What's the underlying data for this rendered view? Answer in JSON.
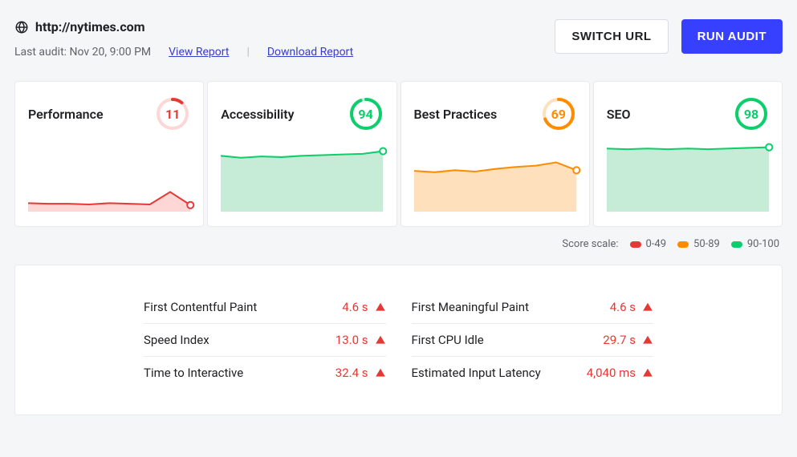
{
  "header": {
    "url": "http://nytimes.com",
    "last_audit_label": "Last audit: Nov 20, 9:00 PM",
    "view_report": "View Report",
    "download_report": "Download Report",
    "separator": "|"
  },
  "buttons": {
    "switch_url": "Switch URL",
    "run_audit": "Run Audit"
  },
  "cards": [
    {
      "title": "Performance",
      "score": 11,
      "level": "red"
    },
    {
      "title": "Accessibility",
      "score": 94,
      "level": "green"
    },
    {
      "title": "Best Practices",
      "score": 69,
      "level": "orange"
    },
    {
      "title": "SEO",
      "score": 98,
      "level": "green"
    }
  ],
  "chart_data": [
    {
      "card": "Performance",
      "type": "area",
      "ylim": [
        0,
        100
      ],
      "xlabel": "",
      "ylabel": "",
      "values": [
        13,
        12,
        12,
        11,
        13,
        12,
        11,
        30,
        10
      ]
    },
    {
      "card": "Accessibility",
      "type": "area",
      "ylim": [
        0,
        100
      ],
      "xlabel": "",
      "ylabel": "",
      "values": [
        85,
        82,
        84,
        83,
        85,
        86,
        87,
        88,
        92
      ]
    },
    {
      "card": "Best Practices",
      "type": "area",
      "ylim": [
        0,
        100
      ],
      "xlabel": "",
      "ylabel": "",
      "values": [
        62,
        60,
        63,
        61,
        65,
        68,
        70,
        75,
        63
      ]
    },
    {
      "card": "SEO",
      "type": "area",
      "ylim": [
        0,
        100
      ],
      "xlabel": "",
      "ylabel": "",
      "values": [
        96,
        95,
        96,
        95,
        96,
        95,
        96,
        97,
        98
      ]
    }
  ],
  "score_scale": {
    "label": "Score scale:",
    "ranges": [
      {
        "label": "0-49",
        "class": "dot-red"
      },
      {
        "label": "50-89",
        "class": "dot-orange"
      },
      {
        "label": "90-100",
        "class": "dot-green"
      }
    ]
  },
  "metrics": [
    {
      "label": "First Contentful Paint",
      "value": "4.6 s",
      "level": "red"
    },
    {
      "label": "First Meaningful Paint",
      "value": "4.6 s",
      "level": "red"
    },
    {
      "label": "Speed Index",
      "value": "13.0 s",
      "level": "red"
    },
    {
      "label": "First CPU Idle",
      "value": "29.7 s",
      "level": "red"
    },
    {
      "label": "Time to Interactive",
      "value": "32.4 s",
      "level": "red"
    },
    {
      "label": "Estimated Input Latency",
      "value": "4,040 ms",
      "level": "red"
    }
  ],
  "colors": {
    "red": "#e53935",
    "orange": "#ff8c00",
    "green": "#0cce6b"
  }
}
